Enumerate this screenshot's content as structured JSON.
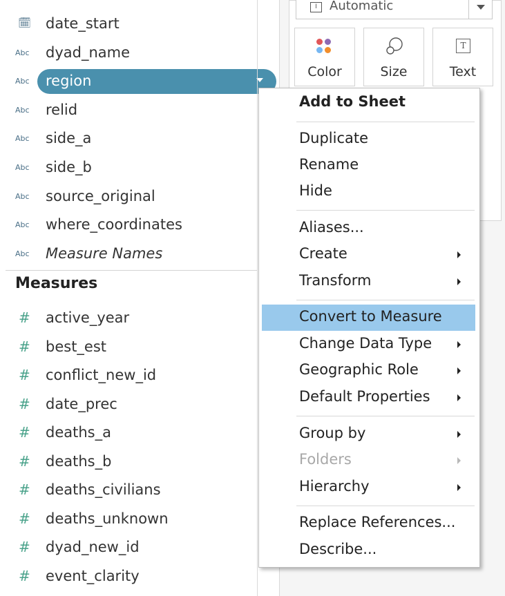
{
  "dimensions": {
    "fields": [
      {
        "type_icon": "calendar-icon",
        "type_label": "🗓",
        "name": "date_start"
      },
      {
        "type_icon": "abc-icon",
        "type_label": "Abc",
        "name": "dyad_name"
      },
      {
        "type_icon": "abc-icon",
        "type_label": "Abc",
        "name": "region",
        "selected": true
      },
      {
        "type_icon": "abc-icon",
        "type_label": "Abc",
        "name": "relid"
      },
      {
        "type_icon": "abc-icon",
        "type_label": "Abc",
        "name": "side_a"
      },
      {
        "type_icon": "abc-icon",
        "type_label": "Abc",
        "name": "side_b"
      },
      {
        "type_icon": "abc-icon",
        "type_label": "Abc",
        "name": "source_original"
      },
      {
        "type_icon": "abc-icon",
        "type_label": "Abc",
        "name": "where_coordinates"
      },
      {
        "type_icon": "abc-icon",
        "type_label": "Abc",
        "name": "Measure Names",
        "italic": true
      }
    ]
  },
  "measures": {
    "header": "Measures",
    "fields": [
      {
        "type_icon": "hash-icon",
        "type_label": "#",
        "name": "active_year"
      },
      {
        "type_icon": "hash-icon",
        "type_label": "#",
        "name": "best_est"
      },
      {
        "type_icon": "hash-icon",
        "type_label": "#",
        "name": "conflict_new_id"
      },
      {
        "type_icon": "hash-icon",
        "type_label": "#",
        "name": "date_prec"
      },
      {
        "type_icon": "hash-icon",
        "type_label": "#",
        "name": "deaths_a"
      },
      {
        "type_icon": "hash-icon",
        "type_label": "#",
        "name": "deaths_b"
      },
      {
        "type_icon": "hash-icon",
        "type_label": "#",
        "name": "deaths_civilians"
      },
      {
        "type_icon": "hash-icon",
        "type_label": "#",
        "name": "deaths_unknown"
      },
      {
        "type_icon": "hash-icon",
        "type_label": "#",
        "name": "dyad_new_id"
      },
      {
        "type_icon": "hash-icon",
        "type_label": "#",
        "name": "event_clarity"
      }
    ]
  },
  "marks": {
    "mark_type": "Automatic",
    "mark_type_icon": "I",
    "buttons": [
      {
        "label": "Color",
        "icon": "color-dots-icon"
      },
      {
        "label": "Size",
        "icon": "size-circles-icon"
      },
      {
        "label": "Text",
        "icon": "text-box-icon"
      }
    ],
    "color_dots": [
      "#e15759",
      "#8e6bb4",
      "#76b7f2",
      "#f28e2b"
    ]
  },
  "context_menu": {
    "items": [
      {
        "label": "Add to Sheet",
        "bold": true
      },
      {
        "separator": true
      },
      {
        "label": "Duplicate"
      },
      {
        "label": "Rename"
      },
      {
        "label": "Hide"
      },
      {
        "separator": true
      },
      {
        "label": "Aliases..."
      },
      {
        "label": "Create",
        "submenu": true
      },
      {
        "label": "Transform",
        "submenu": true
      },
      {
        "separator": true
      },
      {
        "label": "Convert to Measure",
        "highlighted": true
      },
      {
        "label": "Change Data Type",
        "submenu": true
      },
      {
        "label": "Geographic Role",
        "submenu": true
      },
      {
        "label": "Default Properties",
        "submenu": true
      },
      {
        "separator": true
      },
      {
        "label": "Group by",
        "submenu": true
      },
      {
        "label": "Folders",
        "submenu": true,
        "disabled": true
      },
      {
        "label": "Hierarchy",
        "submenu": true
      },
      {
        "separator": true
      },
      {
        "label": "Replace References..."
      },
      {
        "label": "Describe..."
      }
    ]
  },
  "colors": {
    "selected_pill": "#4a90ad",
    "menu_highlight": "#99c9ec",
    "measure_icon": "#49a28a",
    "dimension_icon": "#4a6f87"
  }
}
